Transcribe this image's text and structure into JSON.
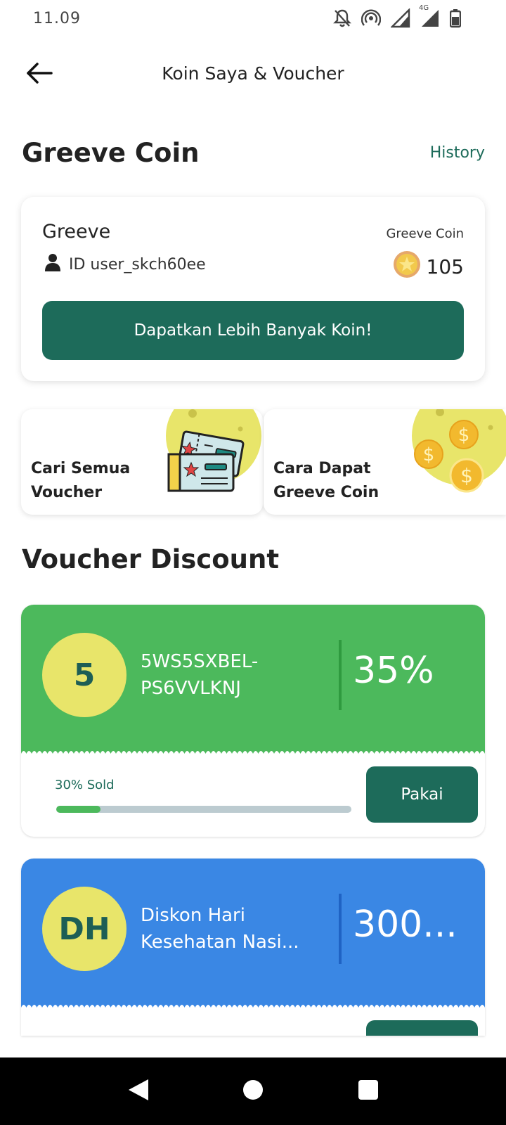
{
  "status_bar": {
    "time": "11.09",
    "icons": [
      "notifications-off-icon",
      "hotspot-icon",
      "signal-icon",
      "signal-4g-icon",
      "battery-icon"
    ],
    "network_label": "4G"
  },
  "app_bar": {
    "title": "Koin Saya & Voucher",
    "back_icon": "arrow-left-icon"
  },
  "coin_section": {
    "title": "Greeve Coin",
    "history_label": "History"
  },
  "coin_card": {
    "name": "Greeve",
    "user_id": "ID user_skch60ee",
    "coin_label": "Greeve Coin",
    "coin_value": "105",
    "button_label": "Dapatkan Lebih Banyak Koin!"
  },
  "promos": [
    {
      "label": "Cari Semua Voucher",
      "icon": "tickets-icon"
    },
    {
      "label": "Cara Dapat Greeve Coin",
      "icon": "coins-icon"
    }
  ],
  "voucher_section": {
    "title": "Voucher Discount"
  },
  "vouchers": [
    {
      "initials": "5",
      "name": "5WS5SXBEL-PS6VVLKNJ",
      "amount": "35%",
      "sold_label": "30% Sold",
      "sold_fraction": 0.15,
      "use_label": "Pakai",
      "color": "#4cb95c",
      "divider_color": "#2f9a3f"
    },
    {
      "initials": "DH",
      "name": "Diskon Hari Kesehatan Nasi...",
      "amount": "300...",
      "sold_label": "",
      "sold_fraction": 0,
      "use_label": "",
      "color": "#3a87e4",
      "divider_color": "#1f63c4"
    }
  ],
  "colors": {
    "primary": "#1d6b5a",
    "accent_yellow": "#e8e56a"
  },
  "nav_bar": {
    "icons": [
      "back-triangle-icon",
      "home-circle-icon",
      "recents-square-icon"
    ]
  }
}
